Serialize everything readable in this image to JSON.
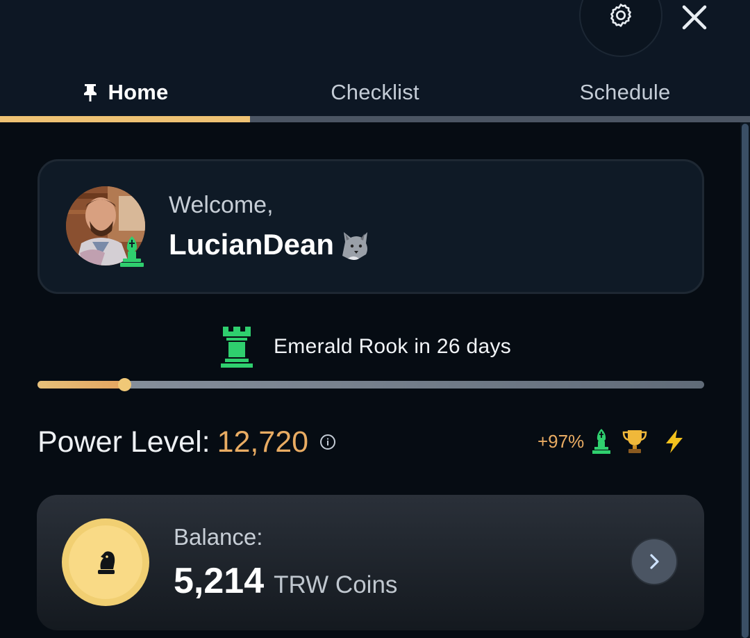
{
  "tabs": [
    {
      "label": "Home",
      "active": true
    },
    {
      "label": "Checklist",
      "active": false
    },
    {
      "label": "Schedule",
      "active": false
    }
  ],
  "welcome": {
    "greeting": "Welcome,",
    "username": "LucianDean",
    "username_emoji": "wolf-icon"
  },
  "rank": {
    "next_rank_text": "Emerald Rook in 26 days",
    "progress_fraction": 0.13
  },
  "power": {
    "label": "Power Level:",
    "value": "12,720",
    "change": "+97%"
  },
  "balance": {
    "label": "Balance:",
    "amount": "5,214",
    "unit": "TRW Coins"
  },
  "colors": {
    "accent_gold": "#eec274",
    "power_value": "#e9ac63",
    "rank_green": "#2fcf6e",
    "background": "#060c13"
  }
}
